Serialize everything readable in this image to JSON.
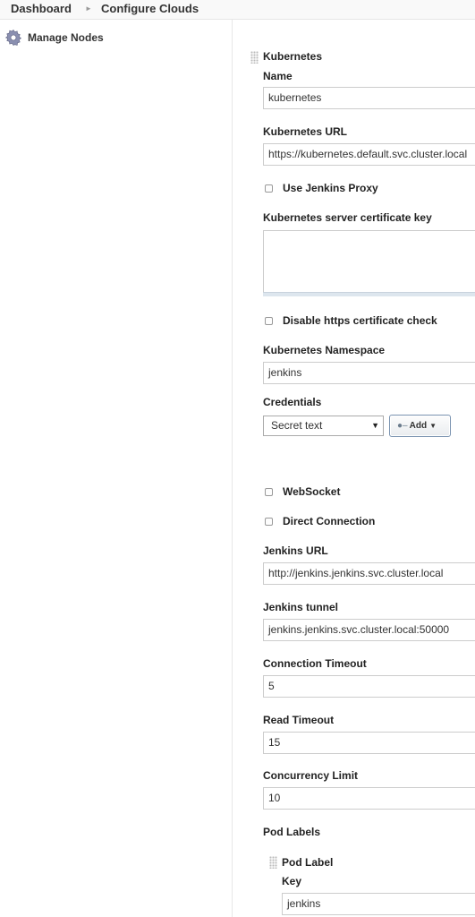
{
  "breadcrumb": {
    "items": [
      "Dashboard",
      "Configure Clouds"
    ],
    "separator": "›"
  },
  "sidebar": {
    "items": [
      {
        "label": "Manage Nodes",
        "icon": "gear-icon"
      }
    ]
  },
  "cloud": {
    "title": "Kubernetes",
    "name": {
      "label": "Name",
      "value": "kubernetes"
    },
    "url": {
      "label": "Kubernetes URL",
      "value": "https://kubernetes.default.svc.cluster.local"
    },
    "use_proxy": {
      "label": "Use Jenkins Proxy",
      "checked": false
    },
    "server_cert": {
      "label": "Kubernetes server certificate key",
      "value": ""
    },
    "disable_https_check": {
      "label": "Disable https certificate check",
      "checked": false
    },
    "namespace": {
      "label": "Kubernetes Namespace",
      "value": "jenkins"
    },
    "credentials": {
      "label": "Credentials",
      "selected": "Secret text",
      "add_label": "Add"
    },
    "websocket": {
      "label": "WebSocket",
      "checked": false
    },
    "direct_connection": {
      "label": "Direct Connection",
      "checked": false
    },
    "jenkins_url": {
      "label": "Jenkins URL",
      "value": "http://jenkins.jenkins.svc.cluster.local"
    },
    "jenkins_tunnel": {
      "label": "Jenkins tunnel",
      "value": "jenkins.jenkins.svc.cluster.local:50000"
    },
    "connection_timeout": {
      "label": "Connection Timeout",
      "value": "5"
    },
    "read_timeout": {
      "label": "Read Timeout",
      "value": "15"
    },
    "concurrency_limit": {
      "label": "Concurrency Limit",
      "value": "10"
    },
    "pod_labels": {
      "label": "Pod Labels",
      "item_title": "Pod Label",
      "key_label": "Key",
      "key_value": "jenkins"
    }
  }
}
